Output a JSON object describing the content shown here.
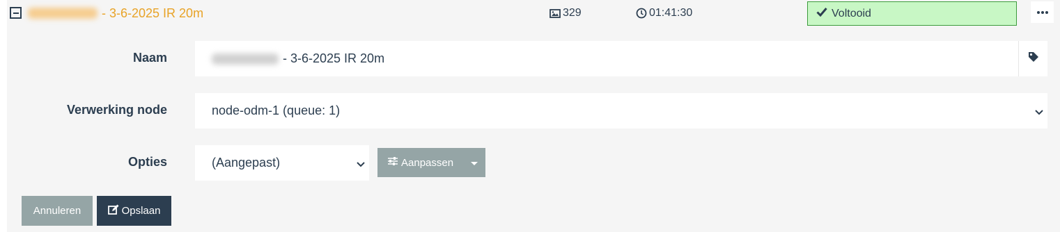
{
  "task": {
    "title_suffix": "- 3-6-2025 IR 20m",
    "image_count": "329",
    "duration": "01:41:30",
    "status": "Voltooid"
  },
  "form": {
    "name_label": "Naam",
    "name_value_suffix": "- 3-6-2025 IR 20m",
    "node_label": "Verwerking node",
    "node_value": "node-odm-1 (queue: 1)",
    "options_label": "Opties",
    "options_value": "(Aangepast)",
    "customize_label": "Aanpassen"
  },
  "actions": {
    "cancel_label": "Annuleren",
    "save_label": "Opslaan"
  },
  "icons": [
    "minus-square-icon",
    "image-icon",
    "clock-icon",
    "check-icon",
    "ellipsis-icon",
    "tag-icon",
    "chevron-down-icon",
    "sliders-icon",
    "caret-down-icon",
    "edit-icon"
  ],
  "colors": {
    "title": "#e8a327",
    "status_bg": "#c8f7c5",
    "status_border": "#3c9a3c",
    "button_gray": "#95a5a6",
    "button_dark": "#2c3e50",
    "panel_bg": "#f5f5f5"
  }
}
